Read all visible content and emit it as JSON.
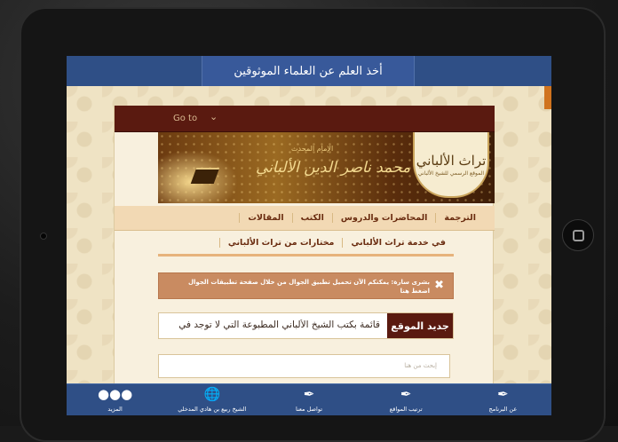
{
  "app": {
    "top_title": "أخذ العلم عن العلماء الموثوقين"
  },
  "site": {
    "goto_label": "Go to",
    "banner": {
      "logo_title": "تراث الألباني",
      "logo_subtitle": "الموقع الرسمي للشيخ الألباني",
      "calligraphy": "محمد ناصر الدين الألباني",
      "calligraphy_sub": "الإمام المحدث"
    },
    "nav_primary": [
      "الترجمة",
      "المحاضرات والدروس",
      "الكتب",
      "المقالات"
    ],
    "nav_secondary": [
      "في خدمة تراث الألباني",
      "مختارات من تراث الألباني"
    ],
    "alert": {
      "text": "بشرى سارة: يمكنكم الآن تحميل تطبيق الجوال من خلال صفحة تطبيقات الجوال اضغط هنا"
    },
    "news": {
      "label": "جديد الموقع",
      "text": "قائمة بكتب الشيخ الألباني المطبوعة التي لا توجد في"
    },
    "search": {
      "placeholder": "إبحث من هنا"
    }
  },
  "bottom_nav": {
    "items": [
      {
        "label": "عن البرنامج",
        "icon": "quill-icon"
      },
      {
        "label": "ترتيب المواقع",
        "icon": "quill-icon"
      },
      {
        "label": "تواصل معنا",
        "icon": "quill-icon"
      },
      {
        "label": "الشيخ ربيع بن هادي المدخلي",
        "icon": "globe-icon"
      },
      {
        "label": "المزيد",
        "icon": "more-dots-icon"
      }
    ]
  },
  "colors": {
    "bar_blue": "#2f4f86",
    "maroon": "#5a1a10",
    "alert": "#c98b61",
    "accent_orange": "#d0731e"
  }
}
